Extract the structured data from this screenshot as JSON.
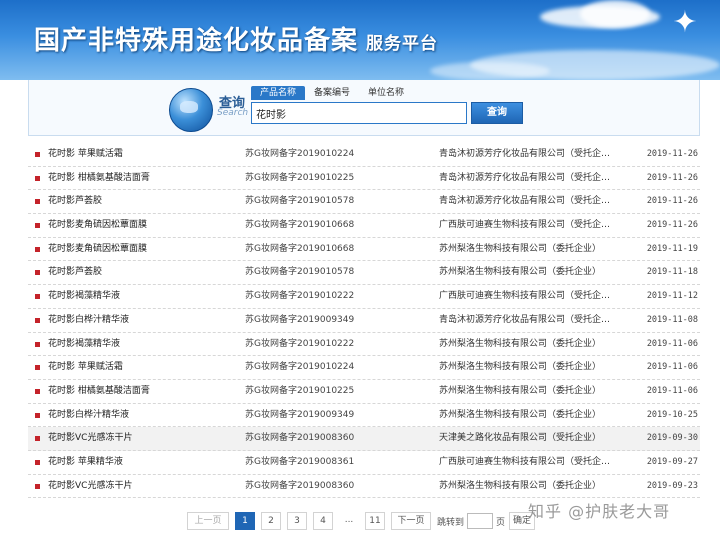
{
  "banner": {
    "title": "国产非特殊用途化妆品备案",
    "subtitle": "服务平台"
  },
  "search": {
    "label": "查询",
    "label_en": "Search",
    "tabs": [
      {
        "label": "产品名称",
        "active": true
      },
      {
        "label": "备案编号",
        "active": false
      },
      {
        "label": "单位名称",
        "active": false
      }
    ],
    "query": "花时影",
    "button_label": "查询"
  },
  "results": [
    {
      "name": "花时影 苹果赋活霜",
      "code": "苏G妆网备字2019010224",
      "company": "青岛沐初源芳疗化妆品有限公司（受托企…",
      "date": "2019-11-26"
    },
    {
      "name": "花时影 柑橘氨基酸洁面膏",
      "code": "苏G妆网备字2019010225",
      "company": "青岛沐初源芳疗化妆品有限公司（受托企…",
      "date": "2019-11-26"
    },
    {
      "name": "花时影芦荟胶",
      "code": "苏G妆网备字2019010578",
      "company": "青岛沐初源芳疗化妆品有限公司（受托企…",
      "date": "2019-11-26"
    },
    {
      "name": "花时影麦角硫因松蕈面膜",
      "code": "苏G妆网备字2019010668",
      "company": "广西肤可迪赛生物科技有限公司（受托企…",
      "date": "2019-11-26"
    },
    {
      "name": "花时影麦角硫因松蕈面膜",
      "code": "苏G妆网备字2019010668",
      "company": "苏州梨洛生物科技有限公司（委托企业）",
      "date": "2019-11-19"
    },
    {
      "name": "花时影芦荟胶",
      "code": "苏G妆网备字2019010578",
      "company": "苏州梨洛生物科技有限公司（委托企业）",
      "date": "2019-11-18"
    },
    {
      "name": "花时影褐藻精华液",
      "code": "苏G妆网备字2019010222",
      "company": "广西肤可迪赛生物科技有限公司（受托企…",
      "date": "2019-11-12"
    },
    {
      "name": "花时影白桦汁精华液",
      "code": "苏G妆网备字2019009349",
      "company": "青岛沐初源芳疗化妆品有限公司（受托企…",
      "date": "2019-11-08"
    },
    {
      "name": "花时影褐藻精华液",
      "code": "苏G妆网备字2019010222",
      "company": "苏州梨洛生物科技有限公司（委托企业）",
      "date": "2019-11-06"
    },
    {
      "name": "花时影 苹果赋活霜",
      "code": "苏G妆网备字2019010224",
      "company": "苏州梨洛生物科技有限公司（委托企业）",
      "date": "2019-11-06"
    },
    {
      "name": "花时影 柑橘氨基酸洁面膏",
      "code": "苏G妆网备字2019010225",
      "company": "苏州梨洛生物科技有限公司（委托企业）",
      "date": "2019-11-06"
    },
    {
      "name": "花时影白桦汁精华液",
      "code": "苏G妆网备字2019009349",
      "company": "苏州梨洛生物科技有限公司（委托企业）",
      "date": "2019-10-25"
    },
    {
      "name": "花时影VC光感冻干片",
      "code": "苏G妆网备字2019008360",
      "company": "天津美之路化妆品有限公司（受托企业）",
      "date": "2019-09-30"
    },
    {
      "name": "花时影 苹果精华液",
      "code": "苏G妆网备字2019008361",
      "company": "广西肤可迪赛生物科技有限公司（受托企…",
      "date": "2019-09-27"
    },
    {
      "name": "花时影VC光感冻干片",
      "code": "苏G妆网备字2019008360",
      "company": "苏州梨洛生物科技有限公司（委托企业）",
      "date": "2019-09-23"
    }
  ],
  "pagination": {
    "prev_label": "上一页",
    "pages": [
      "1",
      "2",
      "3",
      "4"
    ],
    "current": "1",
    "ellipsis": "...",
    "last_page": "11",
    "next_label": "下一页",
    "goto_label": "跳转到",
    "goto_unit": "页",
    "goto_button": "确定"
  },
  "watermark": "知乎 @护肤老大哥"
}
